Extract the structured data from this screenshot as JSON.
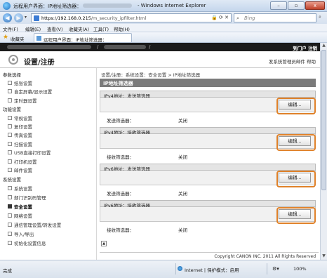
{
  "window": {
    "title": "远程用户界面：IP地址筛选器：",
    "app_suffix": "- Windows Internet Explorer",
    "min_label": "–",
    "max_label": "▫",
    "close_label": "x"
  },
  "address_bar": {
    "url_host": "https://192.168.0.215",
    "url_path": "/m_security_ipfilter.html",
    "refresh_icon": "refresh-icon",
    "stop_label": "✕",
    "search_placeholder": "Bing"
  },
  "menu": [
    "文件(F)",
    "编辑(E)",
    "查看(V)",
    "收藏夹(A)",
    "工具(T)",
    "帮助(H)"
  ],
  "favorites": {
    "label": "收藏夹",
    "tab_title": "远程用户界面：IP地址筛选器："
  },
  "rui": {
    "login_info": "到门户 注销",
    "page_title": "设置/注册",
    "header_links": "发系统管理员邮件  帮助"
  },
  "sidebar": {
    "group_preferences": "参数选择",
    "pref_items": [
      "纸张设置",
      "自定屏幕/显示设置",
      "定时器设置"
    ],
    "group_function": "功能设置",
    "function_items": [
      "常规设置",
      "复印设置",
      "传真设置",
      "扫描设置",
      "USB直接打印设置",
      "打印机设置",
      "邮件设置"
    ],
    "group_system": "系统设置",
    "system_items": [
      "系统设置",
      "部门识别码管理",
      "安全设置",
      "网络设置",
      "通信管理设置/转发设置",
      "导入/导出",
      "初始化设置信息"
    ],
    "active_item": "安全设置"
  },
  "main": {
    "breadcrumb": "设置/注册：系统设置：安全设置 > IP地址筛选器",
    "panel_title": "IP地址筛选器",
    "edit_label": "编辑...",
    "sections": [
      {
        "title": "IPv4地址：发送筛选器",
        "row_label": "发送筛选器：",
        "row_value": "关闭"
      },
      {
        "title": "IPv4地址：接收筛选器",
        "row_label": "接收筛选器：",
        "row_value": "关闭"
      },
      {
        "title": "IPv6地址：发送筛选器",
        "row_label": "发送筛选器：",
        "row_value": "关闭"
      },
      {
        "title": "IPv6地址：接收筛选器",
        "row_label": "接收筛选器：",
        "row_value": "关闭"
      }
    ],
    "to_top_icon": "to-top-icon",
    "copyright": "Copyright CANON INC. 2011 All Rights Reserved"
  },
  "statusbar": {
    "status": "完成",
    "zone": "Internet | 保护模式：启用",
    "zoom": "100%"
  }
}
